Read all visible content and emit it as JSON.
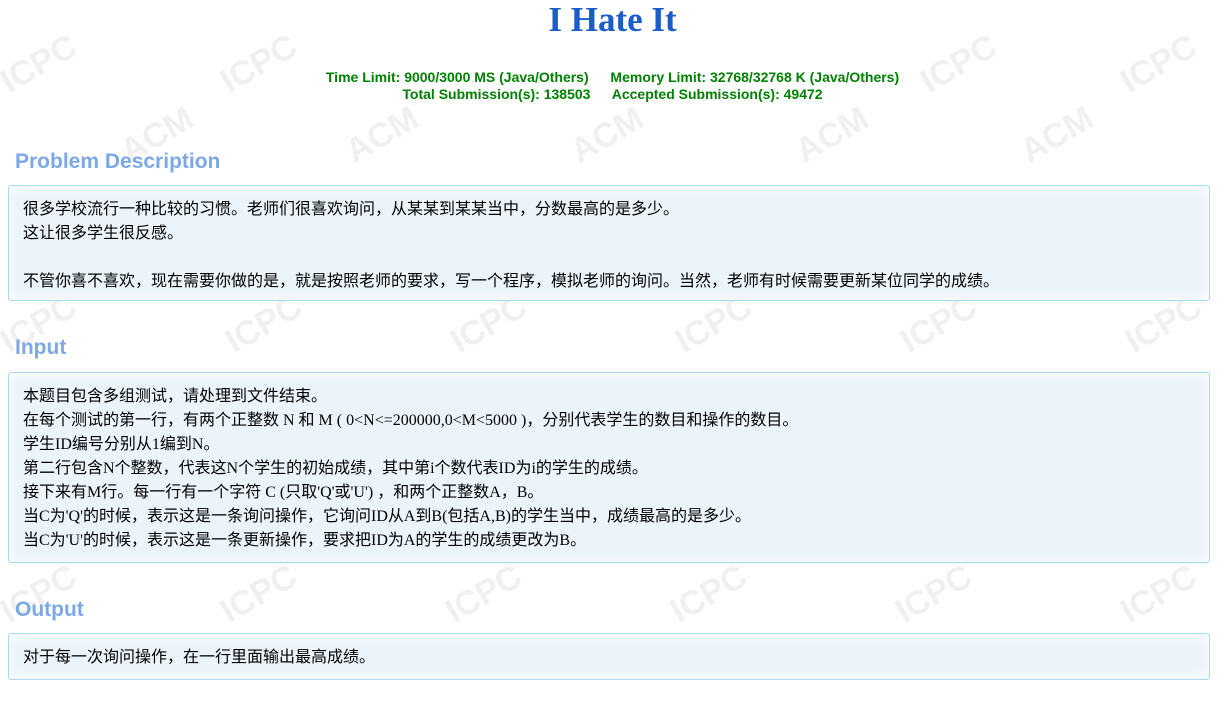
{
  "problem": {
    "title": "I Hate It",
    "time_limit_label": "Time Limit:",
    "time_limit_value": "9000/3000 MS (Java/Others)",
    "memory_limit_label": "Memory Limit:",
    "memory_limit_value": "32768/32768 K (Java/Others)",
    "total_submissions_label": "Total Submission(s):",
    "total_submissions_value": "138503",
    "accepted_submissions_label": "Accepted Submission(s):",
    "accepted_submissions_value": "49472"
  },
  "watermark": {
    "text_acm": "ACM",
    "text_icpc": "ICPC"
  },
  "sections": {
    "description": {
      "title": "Problem Description",
      "lines": [
        "很多学校流行一种比较的习惯。老师们很喜欢询问，从某某到某某当中，分数最高的是多少。",
        "这让很多学生很反感。",
        "",
        "不管你喜不喜欢，现在需要你做的是，就是按照老师的要求，写一个程序，模拟老师的询问。当然，老师有时候需要更新某位同学的成绩。"
      ]
    },
    "input": {
      "title": "Input",
      "lines": [
        "本题目包含多组测试，请处理到文件结束。",
        "在每个测试的第一行，有两个正整数 N 和 M ( 0<N<=200000,0<M<5000 )，分别代表学生的数目和操作的数目。",
        "学生ID编号分别从1编到N。",
        "第二行包含N个整数，代表这N个学生的初始成绩，其中第i个数代表ID为i的学生的成绩。",
        "接下来有M行。每一行有一个字符 C (只取'Q'或'U') ，和两个正整数A，B。",
        "当C为'Q'的时候，表示这是一条询问操作，它询问ID从A到B(包括A,B)的学生当中，成绩最高的是多少。",
        "当C为'U'的时候，表示这是一条更新操作，要求把ID为A的学生的成绩更改为B。"
      ]
    },
    "output": {
      "title": "Output",
      "lines": [
        "对于每一次询问操作，在一行里面输出最高成绩。"
      ]
    }
  }
}
